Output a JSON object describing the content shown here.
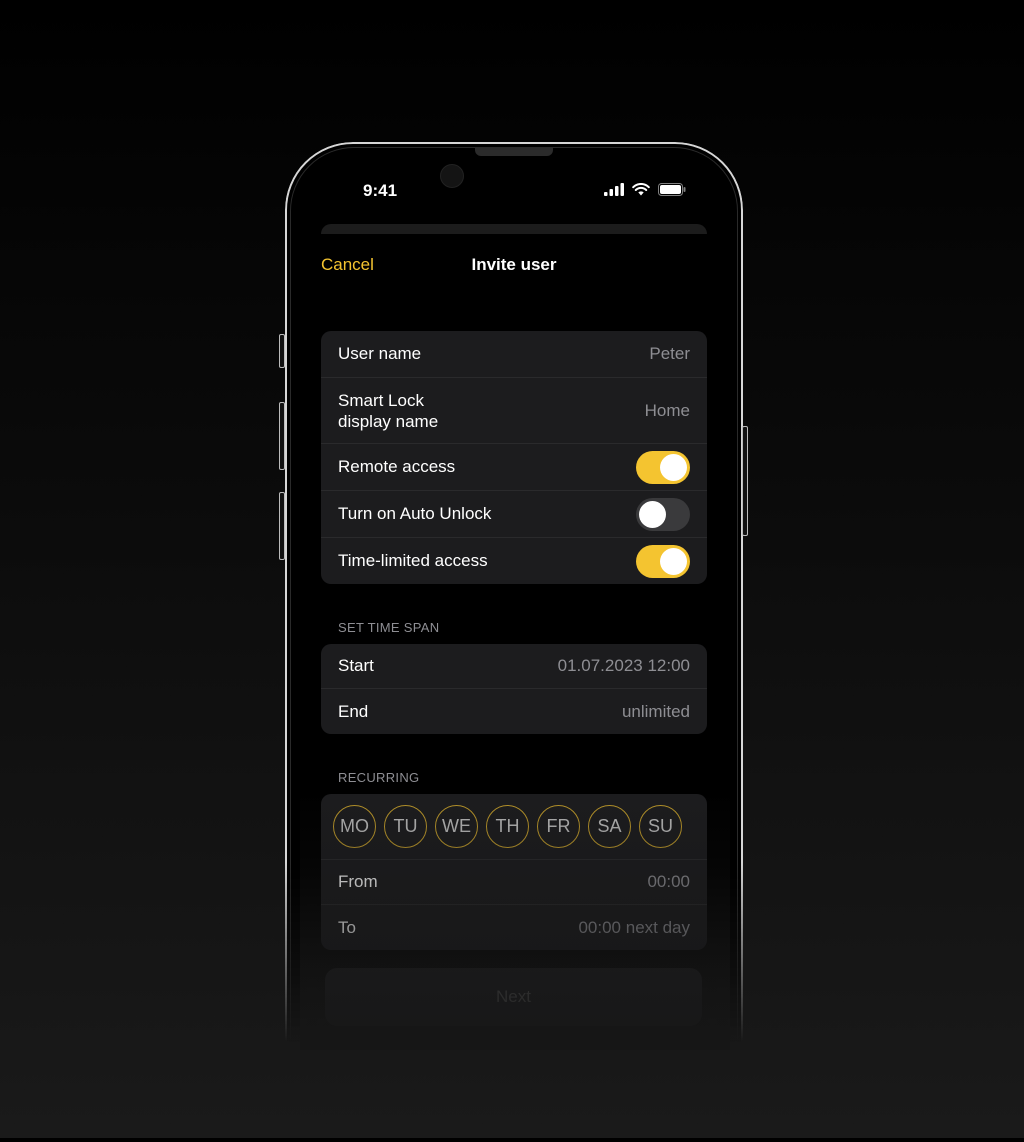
{
  "status_bar": {
    "time": "9:41"
  },
  "nav": {
    "cancel_label": "Cancel",
    "title": "Invite user"
  },
  "details": {
    "user_name_label": "User name",
    "user_name_value": "Peter",
    "display_name_label_line1": "Smart Lock",
    "display_name_label_line2": "display name",
    "display_name_value": "Home",
    "remote_access_label": "Remote access",
    "remote_access_on": true,
    "auto_unlock_label": "Turn on Auto Unlock",
    "auto_unlock_on": false,
    "time_limited_label": "Time-limited access",
    "time_limited_on": true
  },
  "time_span": {
    "section_label": "SET TIME SPAN",
    "start_label": "Start",
    "start_value": "01.07.2023 12:00",
    "end_label": "End",
    "end_value": "unlimited"
  },
  "recurring": {
    "section_label": "RECURRING",
    "days": [
      "MO",
      "TU",
      "WE",
      "TH",
      "FR",
      "SA",
      "SU"
    ],
    "from_label": "From",
    "from_value": "00:00",
    "to_label": "To",
    "to_value": "00:00 next day"
  },
  "next_button_label": "Next",
  "colors": {
    "accent": "#f4c430",
    "background": "#000000",
    "card": "#1c1c1e"
  }
}
